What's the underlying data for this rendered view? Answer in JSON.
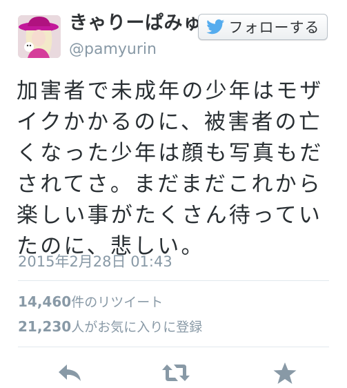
{
  "user": {
    "display_name": "きゃりーぱみゅぱみゅ",
    "handle": "@pamyurin"
  },
  "follow_button": {
    "label": "フォローする",
    "icon": "twitter-bird-icon"
  },
  "tweet": {
    "lines": [
      "加害者で未成年の少年はモザ",
      "イクかかるのに、被害者の亡",
      "くなった少年は顔も写真もだ",
      "されてさ。まだまだこれから",
      "楽しい事がたくさん待ってい",
      "たのに、悲しい。"
    ],
    "timestamp": "2015年2月28日 01:43"
  },
  "stats": {
    "retweets_count": "14,460",
    "retweets_label": "件のリツイート",
    "favorites_count": "21,230",
    "favorites_label": "人がお気に入りに登録"
  },
  "actions": {
    "reply_icon": "reply-icon",
    "retweet_icon": "retweet-icon",
    "favorite_icon": "star-icon"
  },
  "colors": {
    "text": "#292f33",
    "muted": "#8899a6",
    "divider": "#e1e8ed",
    "twitter_blue": "#55acee",
    "action_gray": "#8899a6"
  }
}
